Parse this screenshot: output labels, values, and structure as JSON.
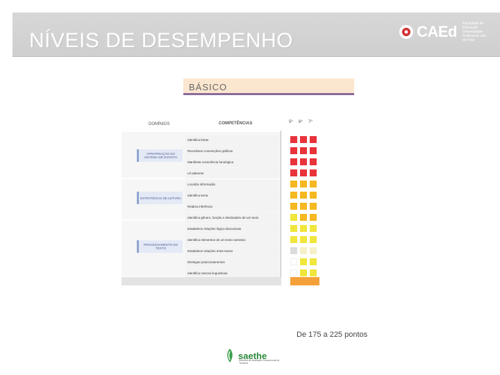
{
  "slide": {
    "title": "NÍVEIS DE DESEMPENHO"
  },
  "logo_caed": {
    "name": "CAEd",
    "institution": "Faculdade de Educação Universidade Federal de Juiz de Fora"
  },
  "level": {
    "title": "BÁSICO"
  },
  "table": {
    "col_domains": "DOMÍNIOS",
    "col_competencies": "COMPETÊNCIAS",
    "col_grades": [
      "5º",
      "6º",
      "7º"
    ],
    "domains": [
      {
        "label": "APROPRIAÇÃO DO SISTEMA DE ESCRITA"
      },
      {
        "label": "ESTRATÉGIAS DE LEITURA"
      },
      {
        "label": "PROCESSAMENTO DO TEXTO"
      }
    ],
    "competencies": [
      "Identifica letras",
      "Reconhece convenções gráficas",
      "Manifesta consciência fonológica",
      "Lê palavras",
      "Localiza informação",
      "Identifica tema",
      "Realiza inferência",
      "Identifica gênero, função e destinatário de um texto",
      "Estabelece relações lógico-discursivas",
      "Identifica elementos de um texto narrativo",
      "Estabelece relações entre textos",
      "Distingue posicionamentos",
      "Identifica marcas linguísticas"
    ],
    "cell_colors": [
      [
        "#e8333a",
        "#e8333a",
        "#e8333a"
      ],
      [
        "#e8333a",
        "#e8333a",
        "#e8333a"
      ],
      [
        "#e8333a",
        "#e8333a",
        "#e8333a"
      ],
      [
        "#e8333a",
        "#e8333a",
        "#e8333a"
      ],
      [
        "#f5b820",
        "#f5b820",
        "#f5b820"
      ],
      [
        "#f5b820",
        "#f5b820",
        "#f5b820"
      ],
      [
        "#f5b820",
        "#f5b820",
        "#f5b820"
      ],
      [
        "#f0e63c",
        "#f5b820",
        "#f5b820"
      ],
      [
        "#f0e63c",
        "#f0e63c",
        "#f0e63c"
      ],
      [
        "#f0e63c",
        "#f0e63c",
        "#f0e63c"
      ],
      [
        "#dcdcdc",
        "#f5f0c8",
        "#f5f0c8"
      ],
      [
        "#ffffff",
        "#f0e63c",
        "#f0e63c"
      ],
      [
        "#ffffff",
        "#f0e63c",
        "#f0e63c"
      ]
    ]
  },
  "range_text": "De 175 a 225 pontos",
  "logo_saethe": {
    "name": "saethe",
    "sub": "Sistema de Avaliação Educacional de Teresina"
  }
}
